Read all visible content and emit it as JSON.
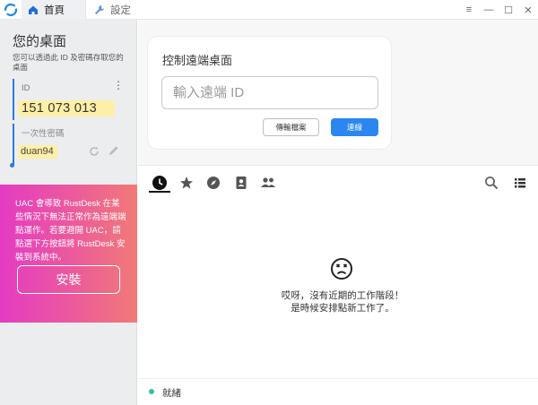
{
  "titlebar": {
    "tabs": [
      {
        "label": "首頁",
        "icon": "home-icon"
      },
      {
        "label": "設定",
        "icon": "wrench-icon"
      }
    ],
    "controls": [
      "menu-icon",
      "minimize-icon",
      "maximize-icon",
      "close-icon"
    ]
  },
  "left": {
    "title": "您的桌面",
    "description": "您可以透過此 ID 及密碼存取您的桌面",
    "id_label": "ID",
    "id_value": "151 073 013",
    "password_label": "一次性密碼",
    "password_value": "duan94",
    "uac_message": "UAC 會導致 RustDesk 在某些情況下無法正常作為遠端端點運作。若要避開 UAC，請點選下方按鈕將 RustDesk 安裝到系統中。",
    "install_label": "安裝"
  },
  "connect": {
    "title": "控制遠端桌面",
    "input_placeholder": "輸入遠端 ID",
    "transfer_label": "傳輸檔案",
    "connect_label": "連線"
  },
  "sessions": {
    "tabs": [
      "recent-icon",
      "star-icon",
      "compass-icon",
      "address-book-icon",
      "group-icon"
    ],
    "tools": [
      "search-icon",
      "list-view-icon"
    ],
    "empty_line1": "哎呀，沒有近期的工作階段！",
    "empty_line2": "是時候安排點新工作了。"
  },
  "status": {
    "text": "就緒",
    "color": "#33c1a0"
  },
  "colors": {
    "accent": "#2b86f0",
    "uac_gradient_start": "#e43bc2",
    "uac_gradient_end": "#f17a77",
    "highlight": "#fdf0a6"
  }
}
